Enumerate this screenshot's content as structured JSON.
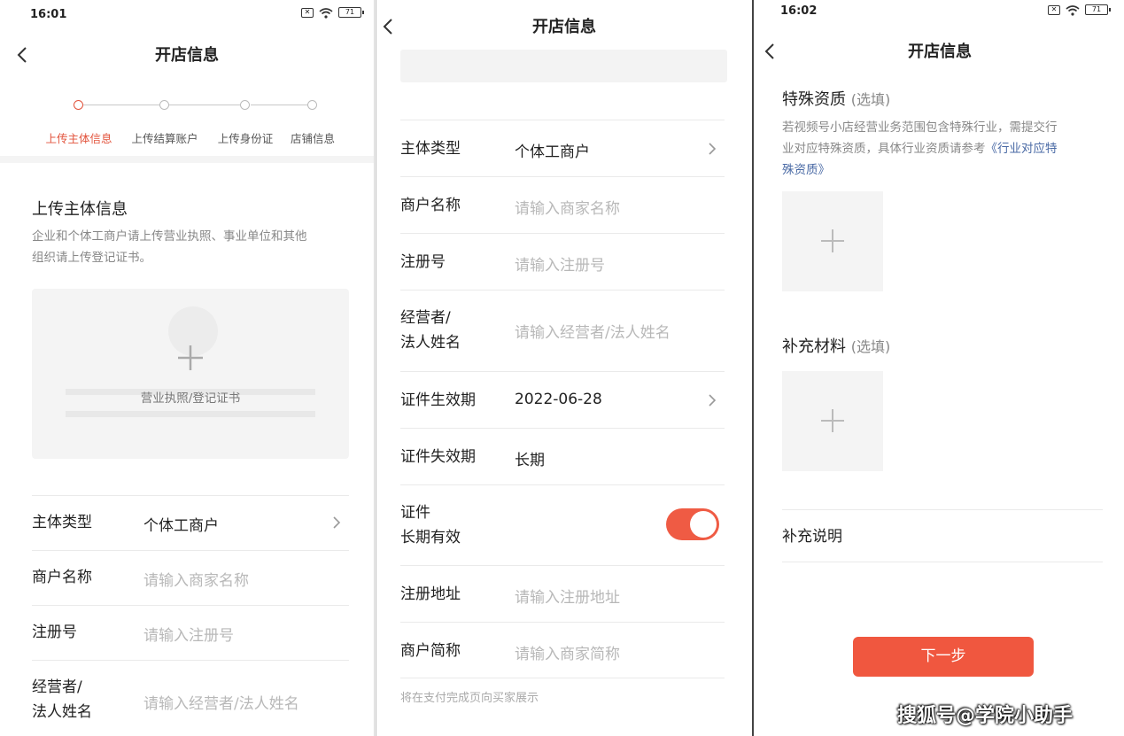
{
  "panel1": {
    "status": {
      "time": "16:01",
      "battery": "71"
    },
    "nav": {
      "title": "开店信息"
    },
    "steps": [
      {
        "label": "上传主体信息",
        "active": true
      },
      {
        "label": "上传结算账户",
        "active": false
      },
      {
        "label": "上传身份证",
        "active": false
      },
      {
        "label": "店铺信息",
        "active": false
      }
    ],
    "section_title": "上传主体信息",
    "section_desc_line1": "企业和个体工商户请上传营业执照、事业单位和其他",
    "section_desc_line2": "组织请上传登记证书。",
    "upload_caption": "营业执照/登记证书",
    "rows": [
      {
        "label": "主体类型",
        "value": "个体工商户"
      },
      {
        "label": "商户名称",
        "placeholder": "请输入商家名称"
      },
      {
        "label": "注册号",
        "placeholder": "请输入注册号"
      },
      {
        "label_line1": "经营者/",
        "label_line2": "法人姓名",
        "placeholder": "请输入经营者/法人姓名"
      }
    ]
  },
  "panel2": {
    "nav": {
      "title": "开店信息"
    },
    "rows": {
      "type": {
        "label": "主体类型",
        "value": "个体工商户"
      },
      "name": {
        "label": "商户名称",
        "placeholder": "请输入商家名称"
      },
      "regno": {
        "label": "注册号",
        "placeholder": "请输入注册号"
      },
      "legal": {
        "label_line1": "经营者/",
        "label_line2": "法人姓名",
        "placeholder": "请输入经营者/法人姓名"
      },
      "start": {
        "label": "证件生效期",
        "value": "2022-06-28"
      },
      "end": {
        "label": "证件失效期",
        "value": "长期"
      },
      "longterm": {
        "label_line1": "证件",
        "label_line2": "长期有效",
        "on": true
      },
      "address": {
        "label": "注册地址",
        "placeholder": "请输入注册地址"
      },
      "short": {
        "label": "商户简称",
        "placeholder": "请输入商家简称"
      }
    },
    "footnote": "将在支付完成页向买家展示"
  },
  "panel3": {
    "status": {
      "time": "16:02",
      "battery": "71"
    },
    "nav": {
      "title": "开店信息"
    },
    "special": {
      "title": "特殊资质",
      "optional": "(选填)",
      "desc_line1": "若视频号小店经营业务范围包含特殊行业，需提交行",
      "desc_line2": "业对应特殊资质，具体行业资质请参考",
      "desc_link1": "《行业对应特",
      "desc_link2": "殊资质》"
    },
    "supplement": {
      "title": "补充材料",
      "optional": "(选填)"
    },
    "note_label": "补充说明",
    "next_label": "下一步"
  },
  "watermark": "搜狐号@学院小助手",
  "colors": {
    "accent": "#E2533C",
    "button": "#F0573F",
    "toggle": "#EF5B44"
  }
}
